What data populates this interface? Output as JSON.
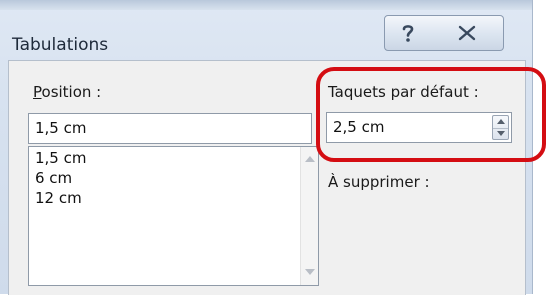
{
  "window": {
    "title": "Tabulations",
    "help_icon": "question-mark-icon",
    "close_icon": "close-x-icon"
  },
  "position": {
    "label": "Position :",
    "value": "1,5 cm",
    "list_items": [
      "1,5 cm",
      "6 cm",
      "12 cm"
    ]
  },
  "default_tabs": {
    "label": "Taquets par défaut :",
    "value": "2,5 cm"
  },
  "to_clear": {
    "label": "À supprimer :"
  },
  "colors": {
    "highlight": "#d40d12",
    "title_bar": "#d6e1ef"
  }
}
